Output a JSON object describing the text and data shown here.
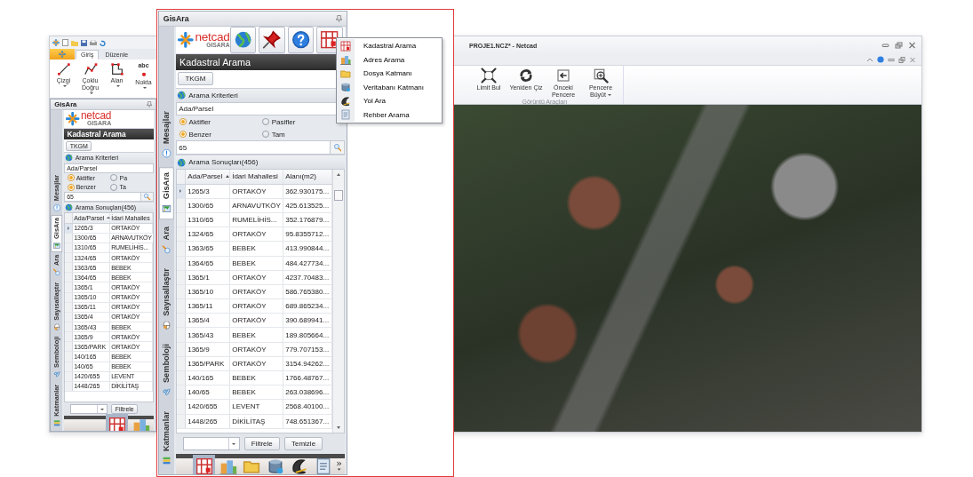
{
  "app_window": {
    "title": "PROJE1.NCZ* - Netcad",
    "ribbon_tabs": [
      {
        "label": "Giriş",
        "selected": true
      },
      {
        "label": "Düzenle",
        "selected": false
      }
    ],
    "draw_tools": [
      {
        "label": "Çizgi",
        "kind": "line",
        "dropdown": true
      },
      {
        "label": "Çoklu Doğru",
        "kind": "polyline",
        "dropdown": true
      },
      {
        "label": "Alan",
        "kind": "area",
        "dropdown": true
      },
      {
        "label": "Nokta",
        "kind": "point",
        "dropdown": true,
        "icon_text": "abc"
      }
    ],
    "view_tools": [
      {
        "label": "Limit Bul",
        "kind": "extent",
        "dropdown": false
      },
      {
        "label": "Yeniden Çiz",
        "kind": "redraw",
        "dropdown": false
      },
      {
        "label": "Önceki Pencere",
        "kind": "previous",
        "dropdown": false
      },
      {
        "label": "Pencere Büyüt",
        "kind": "zoom",
        "dropdown": true
      }
    ],
    "view_group_label": "Görüntü Araçları"
  },
  "panels": [
    {
      "kind": "inset",
      "title": "GisAra",
      "logo": {
        "word": "netcad",
        "sub": "GISARA"
      },
      "heading": "Kadastral Arama",
      "source_button": "TKGM",
      "criteria_label": "Arama Kriterleri",
      "field_value": "Ada/Parsel",
      "option_rows": [
        {
          "options": [
            {
              "label": "Aktifler",
              "selected": true
            },
            {
              "label": "Pa",
              "selected": false
            }
          ]
        },
        {
          "options": [
            {
              "label": "Benzer",
              "selected": true
            },
            {
              "label": "Ta",
              "selected": false
            }
          ]
        }
      ],
      "search_value": "65",
      "results_label": "Arama Sonuçları(456)",
      "columns": [
        {
          "label": "Ada/Parsel",
          "sorted": true
        },
        {
          "label": "İdari Mahalles",
          "sorted": false
        }
      ],
      "rows": [
        {
          "cells": [
            "1265/3",
            "ORTAKÖY"
          ],
          "current": true
        },
        {
          "cells": [
            "1300/65",
            "ARNAVUTKÖY"
          ],
          "current": false
        },
        {
          "cells": [
            "1310/65",
            "RUMELİHİS..."
          ],
          "current": false
        },
        {
          "cells": [
            "1324/65",
            "ORTAKÖY"
          ],
          "current": false
        },
        {
          "cells": [
            "1363/65",
            "BEBEK"
          ],
          "current": false
        },
        {
          "cells": [
            "1364/65",
            "BEBEK"
          ],
          "current": false
        },
        {
          "cells": [
            "1365/1",
            "ORTAKÖY"
          ],
          "current": false
        },
        {
          "cells": [
            "1365/10",
            "ORTAKÖY"
          ],
          "current": false
        },
        {
          "cells": [
            "1365/11",
            "ORTAKÖY"
          ],
          "current": false
        },
        {
          "cells": [
            "1365/4",
            "ORTAKÖY"
          ],
          "current": false
        },
        {
          "cells": [
            "1365/43",
            "BEBEK"
          ],
          "current": false
        },
        {
          "cells": [
            "1365/9",
            "ORTAKÖY"
          ],
          "current": false
        },
        {
          "cells": [
            "1365/PARK",
            "ORTAKÖY"
          ],
          "current": false
        },
        {
          "cells": [
            "140/165",
            "BEBEK"
          ],
          "current": false
        },
        {
          "cells": [
            "140/65",
            "BEBEK"
          ],
          "current": false
        },
        {
          "cells": [
            "1420/655",
            "LEVENT"
          ],
          "current": false
        },
        {
          "cells": [
            "1448/265",
            "DİKİLİTAŞ"
          ],
          "current": false
        }
      ],
      "filter_button": "Filtrele",
      "side_tabs": [
        {
          "label": "Mesajlar",
          "kind": "messages",
          "selected": false
        },
        {
          "label": "GisAra",
          "kind": "gisara",
          "selected": true
        },
        {
          "label": "Ara",
          "kind": "search",
          "selected": false
        },
        {
          "label": "Sayısallaştır",
          "kind": "digitize",
          "selected": false
        },
        {
          "label": "Semboloji",
          "kind": "symbology",
          "selected": false
        },
        {
          "label": "Katmanlar",
          "kind": "layers",
          "selected": false
        }
      ],
      "icon_bar": [
        {
          "kind": "parcel",
          "selected": true
        },
        {
          "kind": "address",
          "selected": false
        }
      ]
    },
    {
      "kind": "main",
      "title": "GisAra",
      "logo": {
        "word": "netcad",
        "sub": "GISARA"
      },
      "heading": "Kadastral Arama",
      "source_button": "TKGM",
      "criteria_label": "Arama Kriterleri",
      "field_value": "Ada/Parsel",
      "option_rows": [
        {
          "options": [
            {
              "label": "Aktifler",
              "selected": true
            },
            {
              "label": "Pasifler",
              "selected": false
            }
          ]
        },
        {
          "options": [
            {
              "label": "Benzer",
              "selected": true
            },
            {
              "label": "Tam",
              "selected": false
            }
          ]
        }
      ],
      "search_value": "65",
      "results_label": "Arama Sonuçları(456)",
      "columns": [
        {
          "label": "Ada/Parsel",
          "sorted": true
        },
        {
          "label": "İdari Mahallesi",
          "sorted": false
        },
        {
          "label": "Alanı(m2)",
          "sorted": false
        }
      ],
      "rows": [
        {
          "cells": [
            "1265/3",
            "ORTAKÖY",
            "362.930175..."
          ],
          "current": true
        },
        {
          "cells": [
            "1300/65",
            "ARNAVUTKÖY",
            "425.613525..."
          ],
          "current": false
        },
        {
          "cells": [
            "1310/65",
            "RUMELİHİS...",
            "352.176879..."
          ],
          "current": false
        },
        {
          "cells": [
            "1324/65",
            "ORTAKÖY",
            "95.8355712..."
          ],
          "current": false
        },
        {
          "cells": [
            "1363/65",
            "BEBEK",
            "413.990844..."
          ],
          "current": false
        },
        {
          "cells": [
            "1364/65",
            "BEBEK",
            "484.427734..."
          ],
          "current": false
        },
        {
          "cells": [
            "1365/1",
            "ORTAKÖY",
            "4237.70483..."
          ],
          "current": false
        },
        {
          "cells": [
            "1365/10",
            "ORTAKÖY",
            "586.765380..."
          ],
          "current": false
        },
        {
          "cells": [
            "1365/11",
            "ORTAKÖY",
            "689.865234..."
          ],
          "current": false
        },
        {
          "cells": [
            "1365/4",
            "ORTAKÖY",
            "390.689941..."
          ],
          "current": false
        },
        {
          "cells": [
            "1365/43",
            "BEBEK",
            "189.805664..."
          ],
          "current": false
        },
        {
          "cells": [
            "1365/9",
            "ORTAKÖY",
            "779.707153..."
          ],
          "current": false
        },
        {
          "cells": [
            "1365/PARK",
            "ORTAKÖY",
            "3154.94262..."
          ],
          "current": false
        },
        {
          "cells": [
            "140/165",
            "BEBEK",
            "1766.48767..."
          ],
          "current": false
        },
        {
          "cells": [
            "140/65",
            "BEBEK",
            "263.038696..."
          ],
          "current": false
        },
        {
          "cells": [
            "1420/655",
            "LEVENT",
            "2568.40100..."
          ],
          "current": false
        },
        {
          "cells": [
            "1448/265",
            "DİKİLİTAŞ",
            "748.651367..."
          ],
          "current": false
        }
      ],
      "filter_button": "Filtrele",
      "clear_button": "Temizle",
      "side_tabs": [
        {
          "label": "Mesajlar",
          "kind": "messages",
          "selected": false
        },
        {
          "label": "GisAra",
          "kind": "gisara",
          "selected": true
        },
        {
          "label": "Ara",
          "kind": "search",
          "selected": false
        },
        {
          "label": "Sayısallaştır",
          "kind": "digitize",
          "selected": false
        },
        {
          "label": "Semboloji",
          "kind": "symbology",
          "selected": false
        },
        {
          "label": "Katmanlar",
          "kind": "layers",
          "selected": false
        }
      ],
      "icon_bar": [
        {
          "kind": "parcel",
          "selected": true
        },
        {
          "kind": "address",
          "selected": false
        },
        {
          "kind": "file",
          "selected": false
        },
        {
          "kind": "database",
          "selected": false
        },
        {
          "kind": "road",
          "selected": false
        },
        {
          "kind": "directory",
          "selected": false
        }
      ],
      "menu": {
        "items": [
          {
            "label": "Kadastral Arama",
            "kind": "parcel"
          },
          {
            "label": "Adres Arama",
            "kind": "address"
          },
          {
            "label": "Dosya Katmanı",
            "kind": "file"
          },
          {
            "label": "Veritabanı Katmanı",
            "kind": "database"
          },
          {
            "label": "Yol Ara",
            "kind": "road"
          },
          {
            "label": "Rehber Arama",
            "kind": "directory"
          }
        ]
      }
    }
  ]
}
